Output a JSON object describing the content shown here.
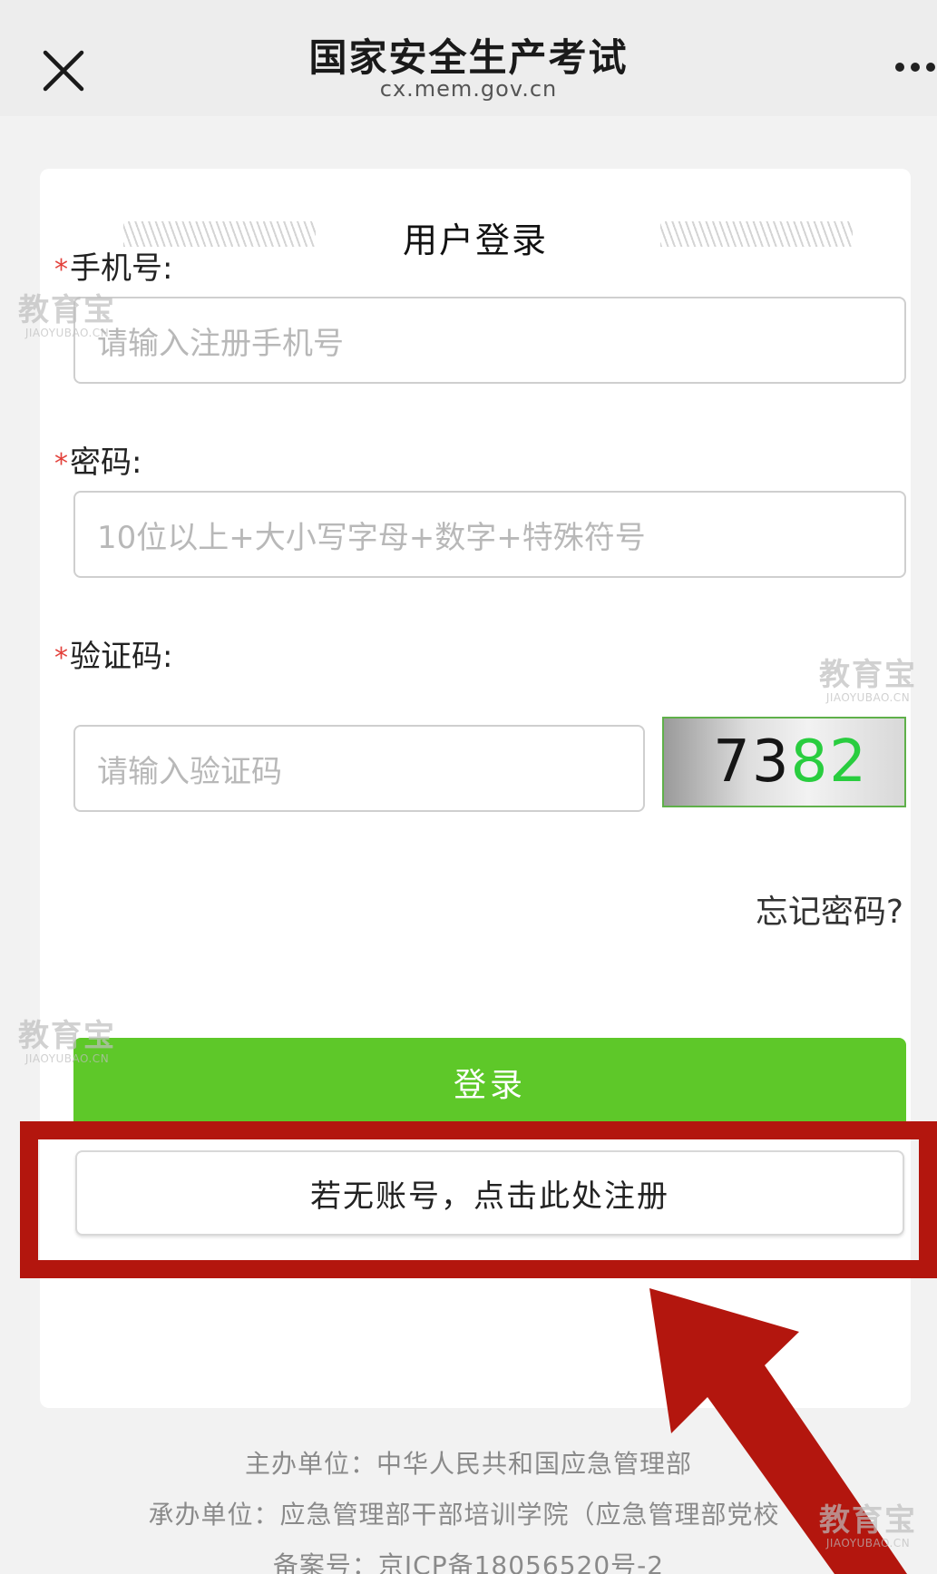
{
  "header": {
    "title": "国家安全生产考试",
    "url": "cx.mem.gov.cn"
  },
  "login_form": {
    "title": "用户登录",
    "required_mark": "*",
    "phone": {
      "label": "手机号:",
      "placeholder": "请输入注册手机号"
    },
    "password": {
      "label": "密码:",
      "placeholder": "10位以上+大小写字母+数字+特殊符号"
    },
    "captcha": {
      "label": "验证码:",
      "placeholder": "请输入验证码",
      "image_digits_dark": "73",
      "image_digits_green": "82"
    },
    "forgot_password": "忘记密码?",
    "login_button": "登录",
    "register_button": "若无账号，点击此处注册"
  },
  "footer": {
    "sponsor": "主办单位：中华人民共和国应急管理部",
    "organizer": "承办单位：应急管理部干部培训学院（应急管理部党校",
    "icp": "备案号：京ICP备18056520号-2"
  },
  "watermark": {
    "cn": "教育宝",
    "en": "JIAOYUBAO.CN"
  },
  "icons": {
    "close": "close-icon",
    "more": "more-icon",
    "arrow": "red-arrow-icon"
  },
  "colors": {
    "accent_green": "#5ec829",
    "required_red": "#e3413b",
    "annotation_red": "#b3160e"
  }
}
